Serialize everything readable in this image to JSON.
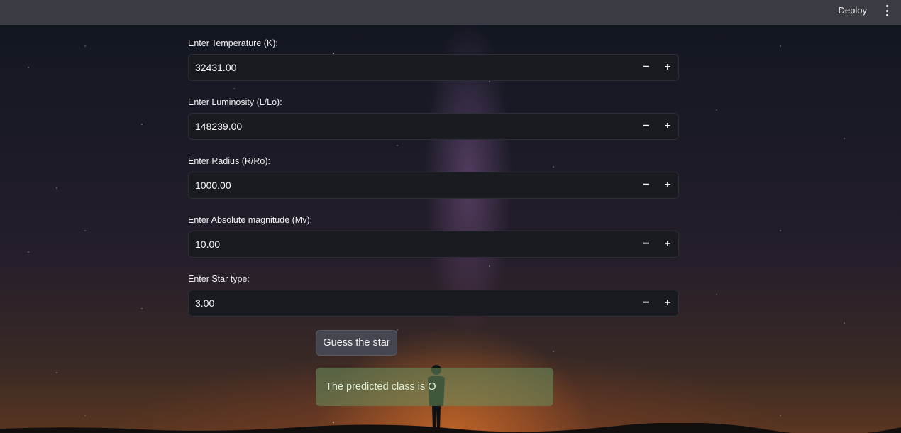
{
  "topbar": {
    "deploy_label": "Deploy",
    "menu_icon": "kebab-menu-icon"
  },
  "form": {
    "fields": [
      {
        "label": "Enter Temperature (K):",
        "value": "32431.00"
      },
      {
        "label": "Enter Luminosity (L/Lo):",
        "value": "148239.00"
      },
      {
        "label": "Enter Radius (R/Ro):",
        "value": "1000.00"
      },
      {
        "label": "Enter Absolute magnitude (Mv):",
        "value": "10.00"
      },
      {
        "label": "Enter Star type:",
        "value": "3.00"
      }
    ],
    "minus_symbol": "−",
    "plus_symbol": "+"
  },
  "predict_button_label": "Guess the star",
  "result_text": "The predicted class is O",
  "colors": {
    "topbar_bg": "#3b3b43",
    "input_bg": "#1a1b21",
    "button_bg": "#45464f",
    "success_bg": "#6c915f"
  }
}
